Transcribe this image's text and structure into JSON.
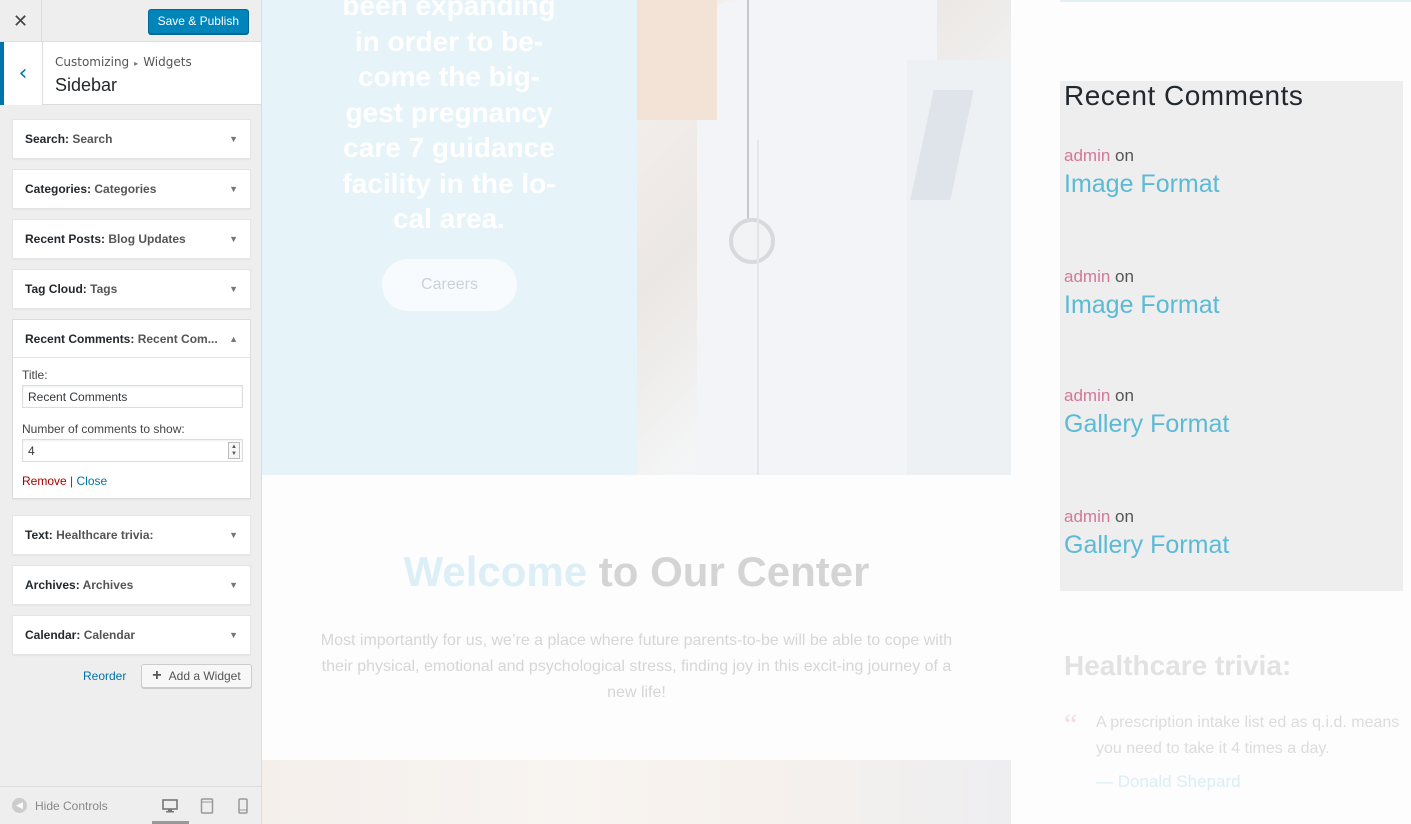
{
  "customizer": {
    "close_glyph": "✕",
    "publish_label": "Save & Publish",
    "breadcrumb": [
      "Customizing",
      "Widgets"
    ],
    "breadcrumb_sep": "▸",
    "section_title": "Sidebar",
    "back_glyph": "‹",
    "widgets": [
      {
        "type": "Search",
        "title": "Search"
      },
      {
        "type": "Categories",
        "title": "Categories"
      },
      {
        "type": "Recent Posts",
        "title": "Blog Updates"
      },
      {
        "type": "Tag Cloud",
        "title": "Tags"
      },
      {
        "type": "Recent Comments",
        "title": "Recent Com..."
      },
      {
        "type": "Text",
        "title": "Healthcare trivia:"
      },
      {
        "type": "Archives",
        "title": "Archives"
      },
      {
        "type": "Calendar",
        "title": "Calendar"
      }
    ],
    "open_widget": {
      "title_label": "Title:",
      "title_value": "Recent Comments",
      "count_label": "Number of comments to show:",
      "count_value": "4",
      "remove_label": "Remove",
      "divider": "|",
      "close_label": "Close"
    },
    "reorder_label": "Reorder",
    "add_widget_label": "Add a Widget",
    "hide_controls_label": "Hide Controls",
    "accent_color": "#0073aa",
    "publish_color": "#0085ba"
  },
  "preview": {
    "hero_lines": [
      "been expanding",
      "in order to be-",
      "come the big-",
      "gest pregnancy",
      "care 7 guidance",
      "facility in the lo-",
      "cal area."
    ],
    "careers_label": "Careers",
    "welcome_highlight": "Welcome",
    "welcome_rest": " to Our Center",
    "welcome_paragraph": "Most importantly for us, we’re a place where future parents-to-be will be able to cope with their physical, emotional and psychological stress, finding joy in this excit-ing journey of a new life!",
    "recent_comments_title": "Recent Comments",
    "comments": [
      {
        "author": "admin",
        "on": " on",
        "post": "Image Format"
      },
      {
        "author": "admin",
        "on": " on",
        "post": "Image Format"
      },
      {
        "author": "admin",
        "on": " on",
        "post": "Gallery Format"
      },
      {
        "author": "admin",
        "on": " on",
        "post": "Gallery Format"
      }
    ],
    "trivia_title": "Healthcare trivia:",
    "trivia_quote": "A prescription intake list ed as q.i.d. means you need to take it 4 times a day.",
    "trivia_author": "— Donald Shepard",
    "author_color": "#d2789a",
    "link_color": "#5bbad5"
  }
}
